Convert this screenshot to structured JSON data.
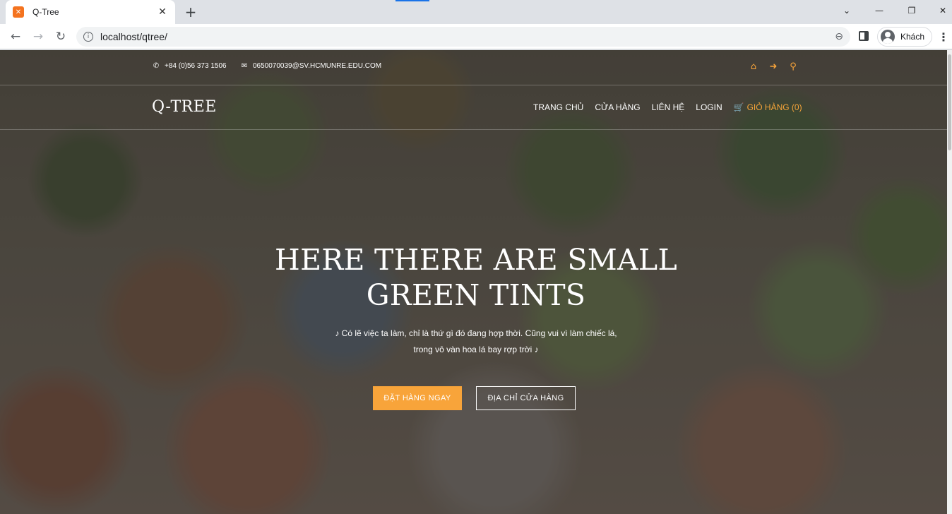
{
  "browser": {
    "tab_title": "Q-Tree",
    "tab_favicon": "xampp-icon",
    "url": "localhost/qtree/",
    "profile_name": "Khách",
    "window_controls": [
      "⌄",
      "—",
      "❐",
      "✕"
    ]
  },
  "site": {
    "topbar": {
      "phone": "+84 (0)56 373 1506",
      "email": "0650070039@SV.HCMUNRE.EDU.COM",
      "icons": [
        "home-icon",
        "sign-in-icon",
        "search-icon"
      ]
    },
    "logo": "Q-TREE",
    "menu": {
      "home": "TRANG CHỦ",
      "shop": "CỬA HÀNG",
      "contact": "LIÊN HỆ",
      "login": "LOGIN",
      "cart": "GIỎ HÀNG (0)"
    },
    "hero": {
      "title_line1": "HERE THERE ARE SMALL",
      "title_line2": "GREEN TINTS",
      "subtitle_line1": "♪ Có lẽ việc ta làm, chỉ là thứ gì đó đang hợp thời. Cũng vui vì làm chiếc lá,",
      "subtitle_line2": "trong vô vàn hoa lá bay rợp trời ♪",
      "btn_primary": "ĐẶT HÀNG NGAY",
      "btn_secondary": "ĐỊA CHỈ CỬA HÀNG"
    },
    "colors": {
      "accent": "#f8a43a",
      "text": "#ffffff"
    }
  }
}
